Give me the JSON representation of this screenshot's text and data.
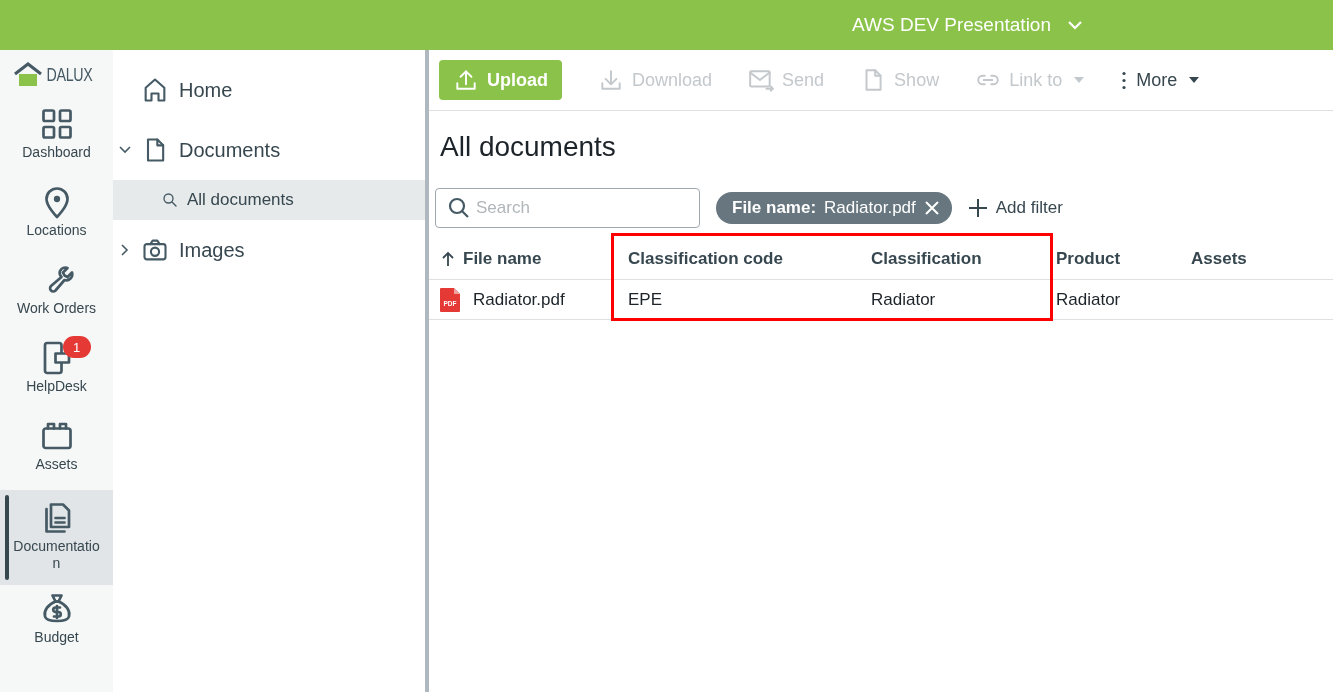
{
  "topbar": {
    "project": "AWS DEV Presentation"
  },
  "logo": {
    "text": "DALUX"
  },
  "rail": [
    {
      "kind": "dashboard",
      "label": "Dashboard",
      "selected": false
    },
    {
      "kind": "location",
      "label": "Locations",
      "selected": false
    },
    {
      "kind": "wrench",
      "label": "Work Orders",
      "selected": false
    },
    {
      "kind": "helpdesk",
      "label": "HelpDesk",
      "selected": false,
      "badge": "1"
    },
    {
      "kind": "assets",
      "label": "Assets",
      "selected": false
    },
    {
      "kind": "documents",
      "label": "Documentation",
      "selected": true
    },
    {
      "kind": "budget",
      "label": "Budget",
      "selected": false
    }
  ],
  "tree": [
    {
      "kind": "home",
      "label": "Home",
      "selected": false
    },
    {
      "kind": "document",
      "label": "Documents",
      "selected": false,
      "expanded": true,
      "children": [
        {
          "kind": "search",
          "label": "All documents",
          "selected": true
        }
      ]
    },
    {
      "kind": "camera",
      "label": "Images",
      "selected": false,
      "expanded": false
    }
  ],
  "toolbar": [
    {
      "kind": "upload",
      "label": "Upload",
      "disabled": false,
      "primary": true
    },
    {
      "kind": "download",
      "label": "Download",
      "disabled": true
    },
    {
      "kind": "send",
      "label": "Send",
      "disabled": true
    },
    {
      "kind": "show",
      "label": "Show",
      "disabled": true
    },
    {
      "kind": "link",
      "label": "Link to",
      "disabled": true,
      "dropdown": true
    },
    {
      "kind": "more",
      "label": "More",
      "disabled": false,
      "dropdown": true
    }
  ],
  "page_title": "All documents",
  "search": {
    "placeholder": "Search"
  },
  "filter_chip": {
    "key": "File name:",
    "value": "Radiator.pdf"
  },
  "add_filter": "Add filter",
  "table": {
    "highlight_box": true,
    "columns": [
      {
        "label": "File name",
        "sorted": true
      },
      {
        "label": "Classification code"
      },
      {
        "label": "Classification"
      },
      {
        "label": "Product"
      },
      {
        "label": "Assets"
      }
    ],
    "rows": [
      {
        "file_icon": "PDF",
        "cells": [
          "Radiator.pdf",
          "EPE",
          "Radiator",
          "Radiator",
          ""
        ]
      }
    ]
  }
}
